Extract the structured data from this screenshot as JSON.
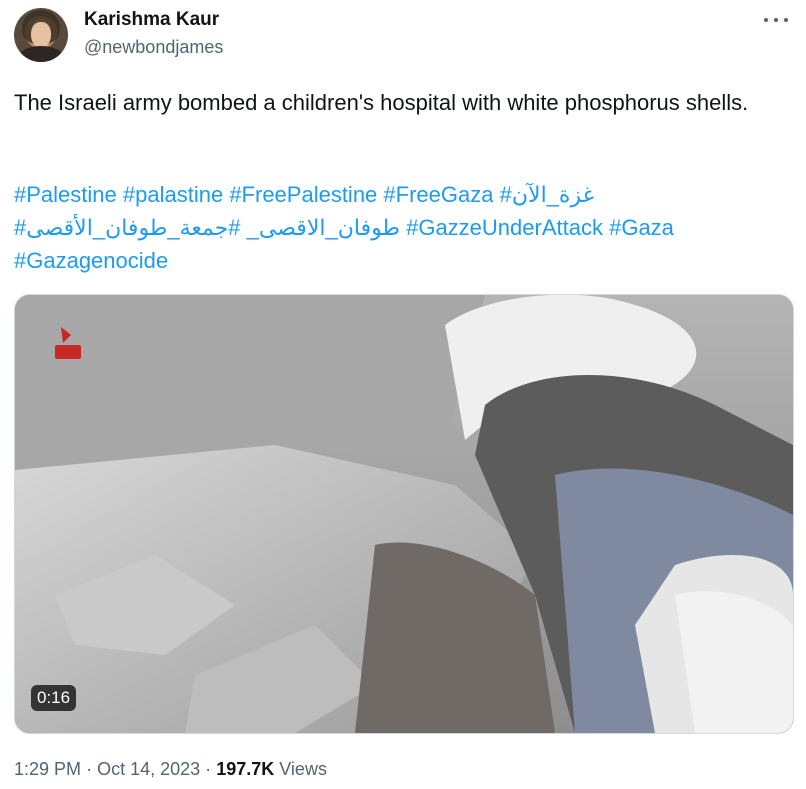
{
  "author": {
    "name": "Karishma Kaur",
    "handle": "@newbondjames"
  },
  "tweet": {
    "text": "The Israeli army bombed a children's hospital with white phosphorus shells.",
    "hashtags_line1": [
      "#Palestine",
      "#palastine",
      "#FreePalestine",
      "#FreeGaza",
      "#غزة_الآن"
    ],
    "hashtags_line2": [
      "#طوفان_الاقصى_",
      "#جمعة_طوفان_الأقصى",
      "#GazzeUnderAttack",
      "#Gaza"
    ],
    "hashtags_line3": [
      "#Gazagenocide"
    ]
  },
  "video": {
    "duration": "0:16"
  },
  "meta": {
    "time": "1:29 PM",
    "date": "Oct 14, 2023",
    "views_count": "197.7K",
    "views_label": "Views",
    "separator": "·"
  },
  "icons": {
    "more": "more-horizontal-icon",
    "avatar": "profile-photo"
  }
}
